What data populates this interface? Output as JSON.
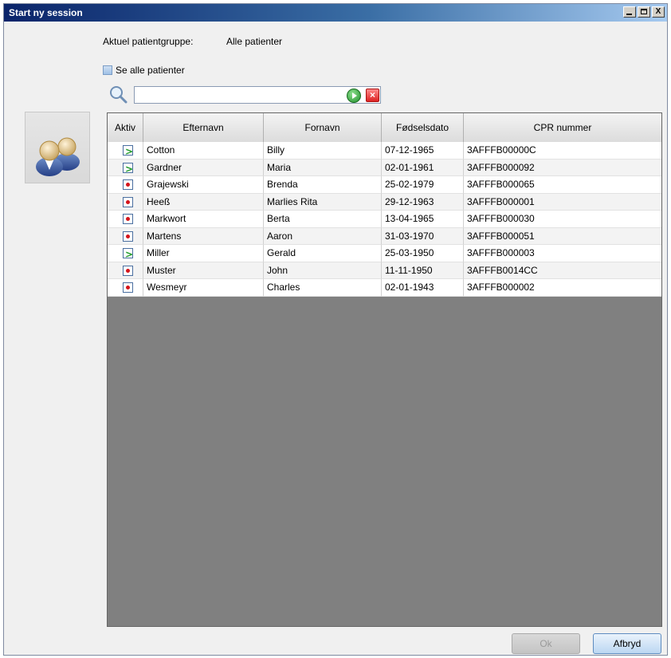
{
  "window": {
    "title": "Start ny session",
    "minimize_label": "_",
    "maximize_label": "",
    "close_label": "X"
  },
  "patient_group": {
    "label": "Aktuel patientgruppe:",
    "value": "Alle patienter"
  },
  "show_all": {
    "label": "Se alle patienter",
    "checked": false
  },
  "search": {
    "value": "",
    "placeholder": "",
    "clear_label": "×"
  },
  "table": {
    "columns": [
      "Aktiv",
      "Efternavn",
      "Fornavn",
      "Fødselsdato",
      "CPR nummer"
    ],
    "rows": [
      {
        "active": true,
        "efternavn": "Cotton",
        "fornavn": "Billy",
        "fodselsdato": "07-12-1965",
        "cpr": "3AFFFB00000C"
      },
      {
        "active": true,
        "efternavn": "Gardner",
        "fornavn": "Maria",
        "fodselsdato": "02-01-1961",
        "cpr": "3AFFFB000092"
      },
      {
        "active": false,
        "efternavn": "Grajewski",
        "fornavn": "Brenda",
        "fodselsdato": "25-02-1979",
        "cpr": "3AFFFB000065"
      },
      {
        "active": false,
        "efternavn": "Heeß",
        "fornavn": "Marlies Rita",
        "fodselsdato": "29-12-1963",
        "cpr": "3AFFFB000001"
      },
      {
        "active": false,
        "efternavn": "Markwort",
        "fornavn": "Berta",
        "fodselsdato": "13-04-1965",
        "cpr": "3AFFFB000030"
      },
      {
        "active": false,
        "efternavn": "Martens",
        "fornavn": "Aaron",
        "fodselsdato": "31-03-1970",
        "cpr": "3AFFFB000051"
      },
      {
        "active": true,
        "efternavn": "Miller",
        "fornavn": "Gerald",
        "fodselsdato": "25-03-1950",
        "cpr": "3AFFFB000003"
      },
      {
        "active": false,
        "efternavn": "Muster",
        "fornavn": "John",
        "fodselsdato": "11-11-1950",
        "cpr": "3AFFFB0014CC"
      },
      {
        "active": false,
        "efternavn": "Wesmeyr",
        "fornavn": "Charles",
        "fodselsdato": "02-01-1943",
        "cpr": "3AFFFB000002"
      }
    ]
  },
  "buttons": {
    "ok": "Ok",
    "cancel": "Afbryd"
  }
}
